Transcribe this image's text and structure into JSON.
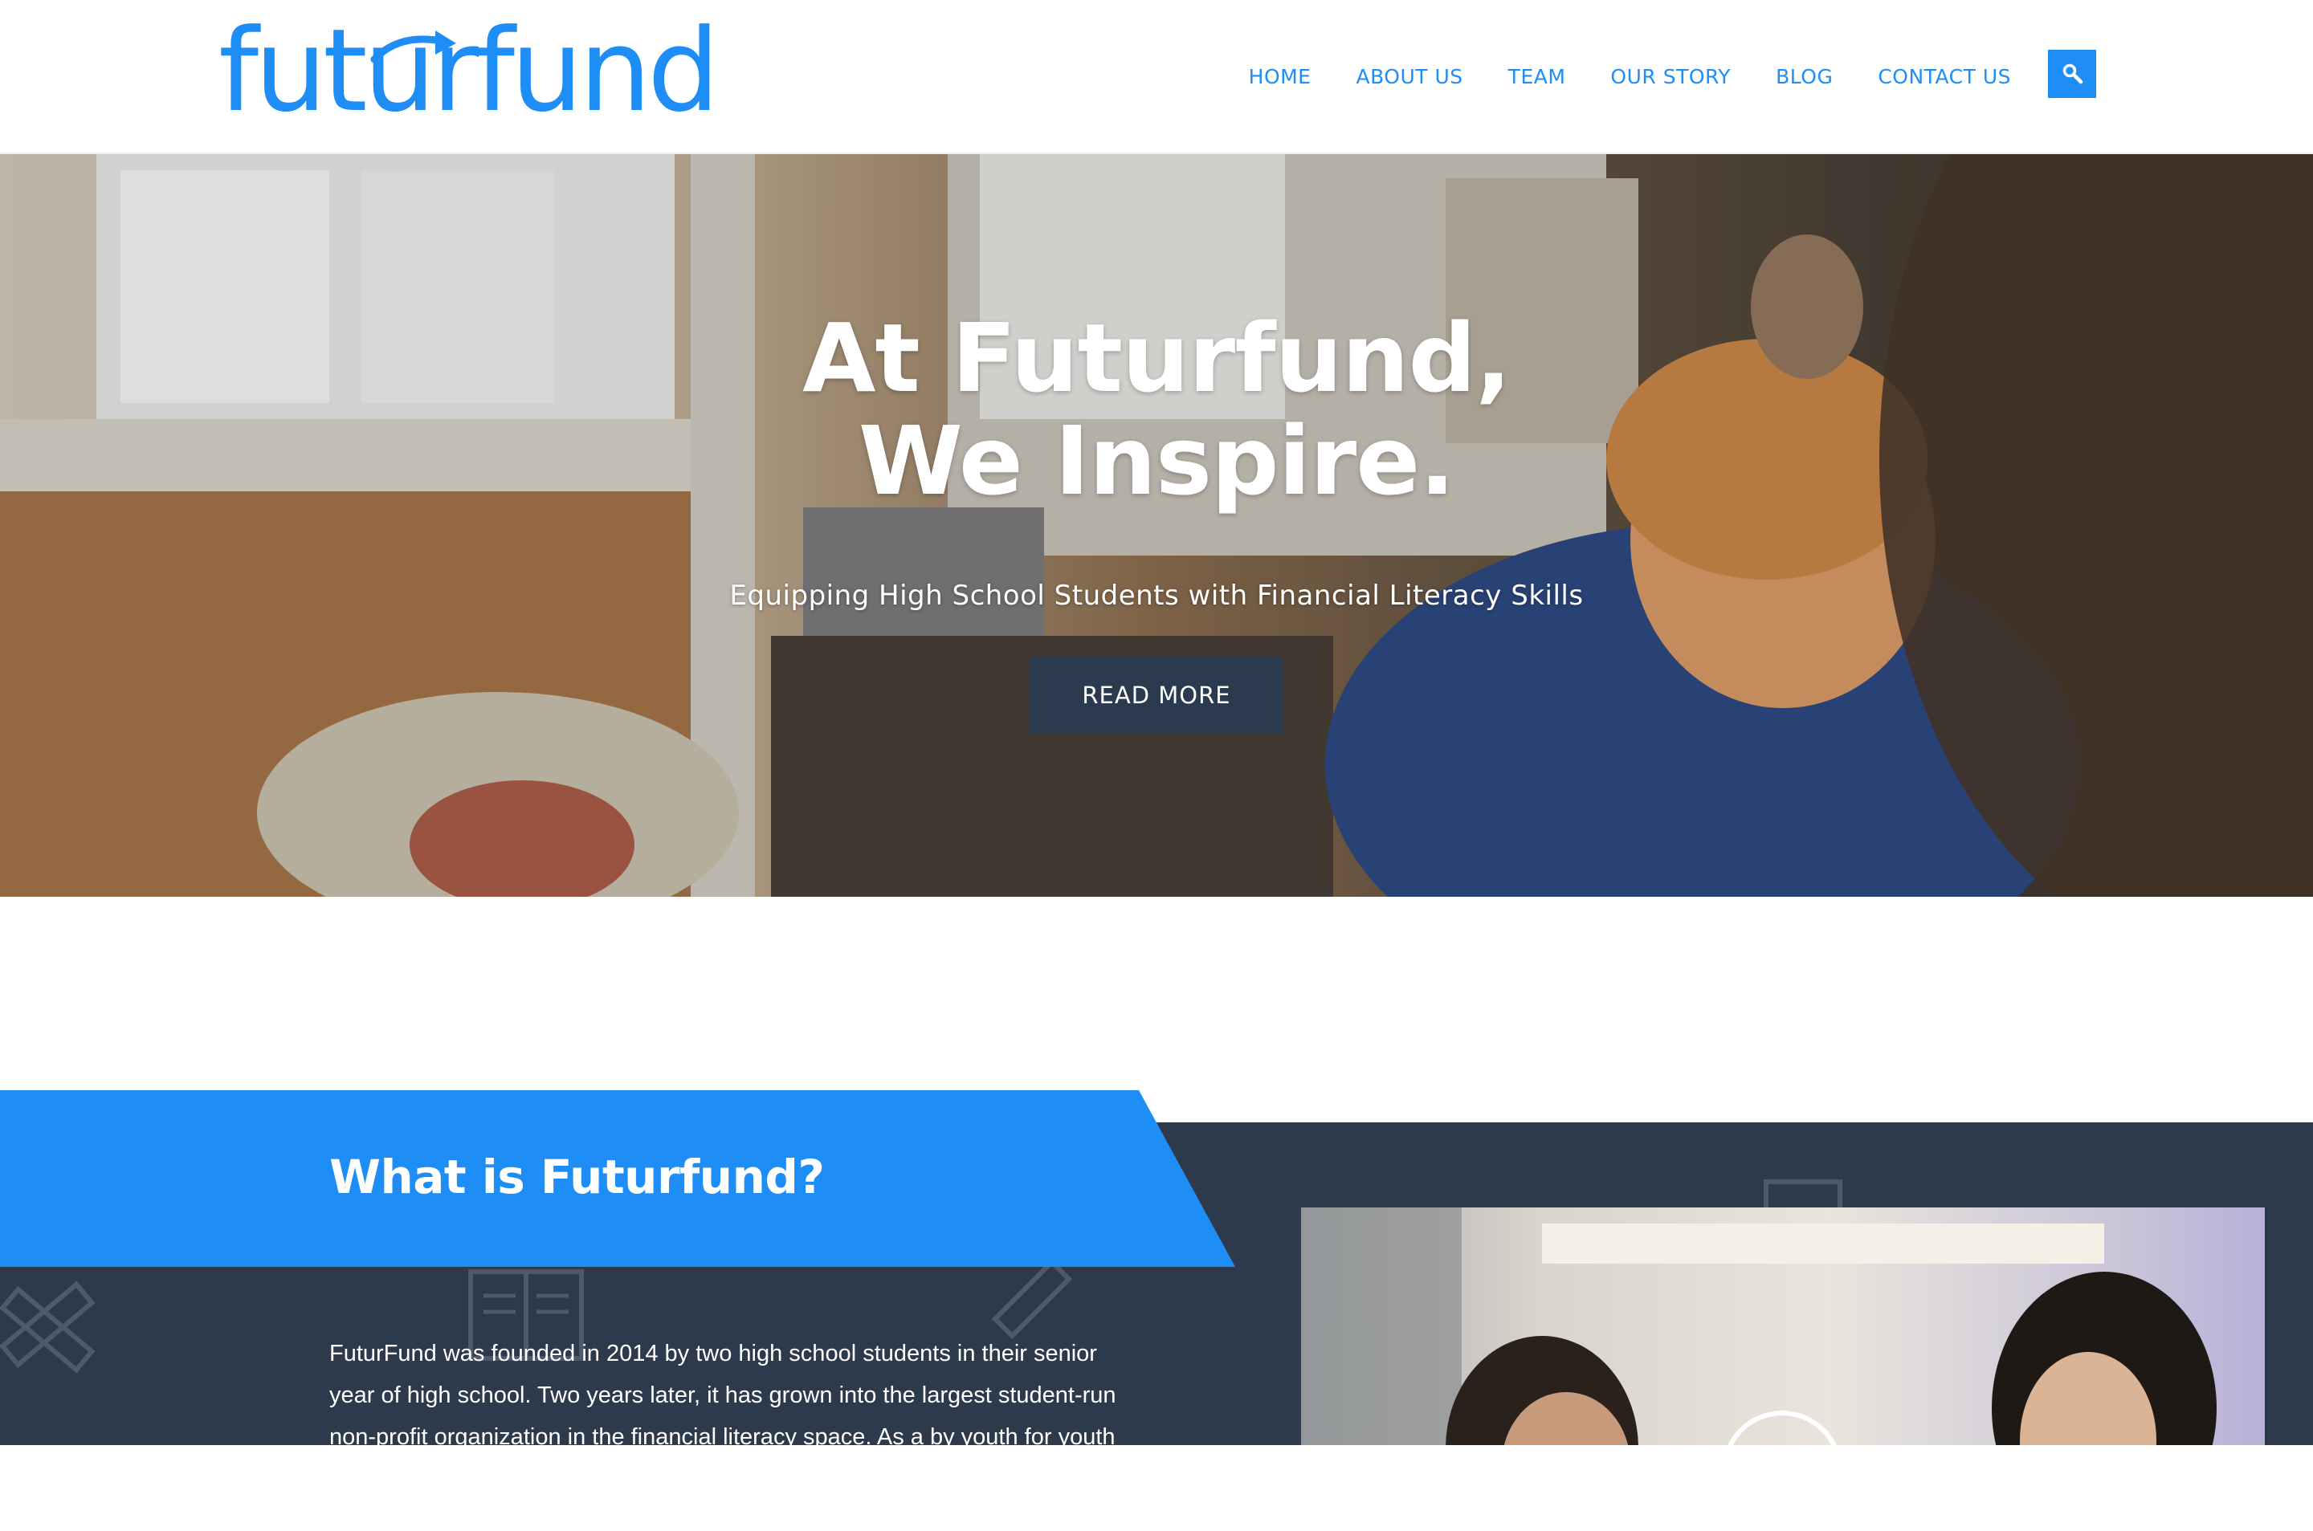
{
  "header": {
    "logo_text": "futurfund",
    "nav": [
      "HOME",
      "ABOUT US",
      "TEAM",
      "OUR STORY",
      "BLOG",
      "CONTACT US"
    ],
    "search_icon": "search-icon"
  },
  "hero": {
    "title_line1": "At Futurfund,",
    "title_line2": "We Inspire.",
    "subtitle": "Equipping High School Students with Financial Literacy Skills",
    "button_label": "READ MORE"
  },
  "about": {
    "heading": "What is Futurfund?",
    "body": "FuturFund was founded in 2014 by two high school students in their senior year of high school. Two years later, it has grown into the largest student-run non-profit organization in the financial literacy space. As a by youth for youth",
    "decor_icons": [
      "ruler-pencil-icon",
      "book-icon",
      "pencil-icon",
      "clipboard-icon"
    ],
    "video_icon": "play-icon"
  },
  "colors": {
    "brand_blue": "#1e8ef6",
    "dark_navy": "#2d3a4b",
    "button_navy": "#2b3a4f",
    "white": "#ffffff"
  }
}
